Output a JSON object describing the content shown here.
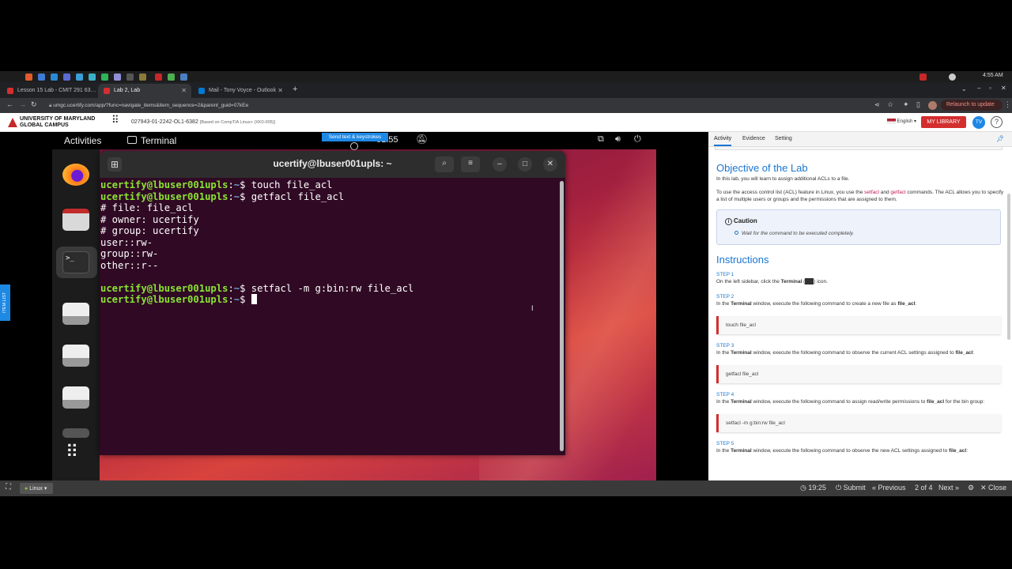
{
  "browser": {
    "tabs": [
      {
        "title": "Lesson 15 Lab - CMIT 291 63…",
        "icon_color": "#d32f2f"
      },
      {
        "title": "Lab 2, Lab",
        "icon_color": "#d32f2f"
      },
      {
        "title": "Mail - Tony Voyce - Outlook",
        "icon_color": "#0078d4"
      }
    ],
    "new_tab": "+",
    "url": "umgc.ucertify.com/app/?func=navigate_items&item_sequence=2&parent_guid=07kEe",
    "relaunch_label": "Relaunch to update",
    "tray_time": "4:55 AM"
  },
  "header": {
    "logo_line1": "UNIVERSITY OF MARYLAND",
    "logo_line2": "GLOBAL CAMPUS",
    "course_id": "027943-01-2242-OL1-6382",
    "course_based": "[Based on CompTIA Linux+ (XK0-005)]",
    "language": "English",
    "my_library": "MY LIBRARY",
    "avatar": "TV",
    "help": "?"
  },
  "vm": {
    "send_keys": "Send text & keystrokes",
    "activities": "Activities",
    "app_name": "Terminal",
    "clock": "01:55",
    "term_title": "ucertify@lbuser001upls: ~",
    "prompt_user": "ucertify@lbuser001upls",
    "prompt_path": "~",
    "lines": [
      {
        "type": "cmd",
        "text": "touch file_acl"
      },
      {
        "type": "cmd",
        "text": "getfacl file_acl"
      },
      {
        "type": "out",
        "text": "# file: file_acl"
      },
      {
        "type": "out",
        "text": "# owner: ucertify"
      },
      {
        "type": "out",
        "text": "# group: ucertify"
      },
      {
        "type": "out",
        "text": "user::rw-"
      },
      {
        "type": "out",
        "text": "group::rw-"
      },
      {
        "type": "out",
        "text": "other::r--"
      },
      {
        "type": "out",
        "text": ""
      },
      {
        "type": "cmd",
        "text": "setfacl -m g:bin:rw file_acl"
      },
      {
        "type": "cmd",
        "text": ""
      }
    ],
    "item_list": "ITEM LIST"
  },
  "panel": {
    "tabs": [
      "Activity",
      "Evidence",
      "Setting"
    ],
    "objective_title": "Objective of the Lab",
    "objective_text": "In this lab, you will learn to assign additional ACLs to a file.",
    "acl_text_1": "To use the access control list (ACL) feature in Linux, you use the ",
    "acl_setfacl": "setfacl",
    "acl_and": " and ",
    "acl_getfacl": "getfacl",
    "acl_text_2": " commands. The ACL allows you to specify a list of multiple users or groups and the permissions that are assigned to them.",
    "caution_title": "Caution",
    "caution_text": "Wait for the command to be executed completely.",
    "instructions_title": "Instructions",
    "step1_label": "STEP 1",
    "step1_a": "On the left sidebar, click the ",
    "step1_b": "Terminal",
    "step1_c": " icon.",
    "step2_label": "STEP 2",
    "step2_a": "In the ",
    "step2_b": "Terminal",
    "step2_c": " window, execute the following command to create a new file as ",
    "step2_d": "file_acl",
    "step2_e": ":",
    "step2_code": "touch file_acl",
    "step3_label": "STEP 3",
    "step3_a": "In the ",
    "step3_b": "Terminal",
    "step3_c": " window, execute the following command to observe the current ACL settings assigned to ",
    "step3_d": "file_acl",
    "step3_e": ":",
    "step3_code": "getfacl file_acl",
    "step4_label": "STEP 4",
    "step4_a": "In the ",
    "step4_b": "Terminal",
    "step4_c": " window, execute the following command to assign read/write permissions to ",
    "step4_d": "file_acl",
    "step4_e": " for the bin group:",
    "step4_code": "setfacl -m g:bin:rw file_acl",
    "step5_label": "STEP 5",
    "step5_a": "In the ",
    "step5_b": "Terminal",
    "step5_c": " window, execute the following command to observe the new ACL settings assigned to ",
    "step5_d": "file_acl",
    "step5_e": ":"
  },
  "bottom": {
    "linux": "Linux",
    "timer": "19:25",
    "submit": "Submit",
    "previous": "Previous",
    "page": "2 of 4",
    "next": "Next",
    "close": "Close"
  }
}
